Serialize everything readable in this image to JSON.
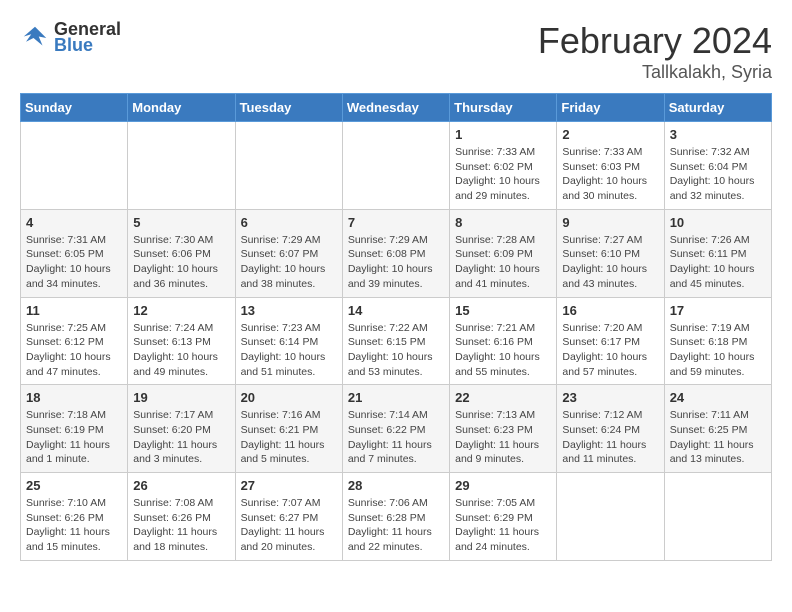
{
  "header": {
    "logo_line1": "General",
    "logo_line2": "Blue",
    "main_title": "February 2024",
    "subtitle": "Tallkalakh, Syria"
  },
  "days_of_week": [
    "Sunday",
    "Monday",
    "Tuesday",
    "Wednesday",
    "Thursday",
    "Friday",
    "Saturday"
  ],
  "weeks": [
    [
      {
        "day": "",
        "info": ""
      },
      {
        "day": "",
        "info": ""
      },
      {
        "day": "",
        "info": ""
      },
      {
        "day": "",
        "info": ""
      },
      {
        "day": "1",
        "info": "Sunrise: 7:33 AM\nSunset: 6:02 PM\nDaylight: 10 hours and 29 minutes."
      },
      {
        "day": "2",
        "info": "Sunrise: 7:33 AM\nSunset: 6:03 PM\nDaylight: 10 hours and 30 minutes."
      },
      {
        "day": "3",
        "info": "Sunrise: 7:32 AM\nSunset: 6:04 PM\nDaylight: 10 hours and 32 minutes."
      }
    ],
    [
      {
        "day": "4",
        "info": "Sunrise: 7:31 AM\nSunset: 6:05 PM\nDaylight: 10 hours and 34 minutes."
      },
      {
        "day": "5",
        "info": "Sunrise: 7:30 AM\nSunset: 6:06 PM\nDaylight: 10 hours and 36 minutes."
      },
      {
        "day": "6",
        "info": "Sunrise: 7:29 AM\nSunset: 6:07 PM\nDaylight: 10 hours and 38 minutes."
      },
      {
        "day": "7",
        "info": "Sunrise: 7:29 AM\nSunset: 6:08 PM\nDaylight: 10 hours and 39 minutes."
      },
      {
        "day": "8",
        "info": "Sunrise: 7:28 AM\nSunset: 6:09 PM\nDaylight: 10 hours and 41 minutes."
      },
      {
        "day": "9",
        "info": "Sunrise: 7:27 AM\nSunset: 6:10 PM\nDaylight: 10 hours and 43 minutes."
      },
      {
        "day": "10",
        "info": "Sunrise: 7:26 AM\nSunset: 6:11 PM\nDaylight: 10 hours and 45 minutes."
      }
    ],
    [
      {
        "day": "11",
        "info": "Sunrise: 7:25 AM\nSunset: 6:12 PM\nDaylight: 10 hours and 47 minutes."
      },
      {
        "day": "12",
        "info": "Sunrise: 7:24 AM\nSunset: 6:13 PM\nDaylight: 10 hours and 49 minutes."
      },
      {
        "day": "13",
        "info": "Sunrise: 7:23 AM\nSunset: 6:14 PM\nDaylight: 10 hours and 51 minutes."
      },
      {
        "day": "14",
        "info": "Sunrise: 7:22 AM\nSunset: 6:15 PM\nDaylight: 10 hours and 53 minutes."
      },
      {
        "day": "15",
        "info": "Sunrise: 7:21 AM\nSunset: 6:16 PM\nDaylight: 10 hours and 55 minutes."
      },
      {
        "day": "16",
        "info": "Sunrise: 7:20 AM\nSunset: 6:17 PM\nDaylight: 10 hours and 57 minutes."
      },
      {
        "day": "17",
        "info": "Sunrise: 7:19 AM\nSunset: 6:18 PM\nDaylight: 10 hours and 59 minutes."
      }
    ],
    [
      {
        "day": "18",
        "info": "Sunrise: 7:18 AM\nSunset: 6:19 PM\nDaylight: 11 hours and 1 minute."
      },
      {
        "day": "19",
        "info": "Sunrise: 7:17 AM\nSunset: 6:20 PM\nDaylight: 11 hours and 3 minutes."
      },
      {
        "day": "20",
        "info": "Sunrise: 7:16 AM\nSunset: 6:21 PM\nDaylight: 11 hours and 5 minutes."
      },
      {
        "day": "21",
        "info": "Sunrise: 7:14 AM\nSunset: 6:22 PM\nDaylight: 11 hours and 7 minutes."
      },
      {
        "day": "22",
        "info": "Sunrise: 7:13 AM\nSunset: 6:23 PM\nDaylight: 11 hours and 9 minutes."
      },
      {
        "day": "23",
        "info": "Sunrise: 7:12 AM\nSunset: 6:24 PM\nDaylight: 11 hours and 11 minutes."
      },
      {
        "day": "24",
        "info": "Sunrise: 7:11 AM\nSunset: 6:25 PM\nDaylight: 11 hours and 13 minutes."
      }
    ],
    [
      {
        "day": "25",
        "info": "Sunrise: 7:10 AM\nSunset: 6:26 PM\nDaylight: 11 hours and 15 minutes."
      },
      {
        "day": "26",
        "info": "Sunrise: 7:08 AM\nSunset: 6:26 PM\nDaylight: 11 hours and 18 minutes."
      },
      {
        "day": "27",
        "info": "Sunrise: 7:07 AM\nSunset: 6:27 PM\nDaylight: 11 hours and 20 minutes."
      },
      {
        "day": "28",
        "info": "Sunrise: 7:06 AM\nSunset: 6:28 PM\nDaylight: 11 hours and 22 minutes."
      },
      {
        "day": "29",
        "info": "Sunrise: 7:05 AM\nSunset: 6:29 PM\nDaylight: 11 hours and 24 minutes."
      },
      {
        "day": "",
        "info": ""
      },
      {
        "day": "",
        "info": ""
      }
    ]
  ]
}
